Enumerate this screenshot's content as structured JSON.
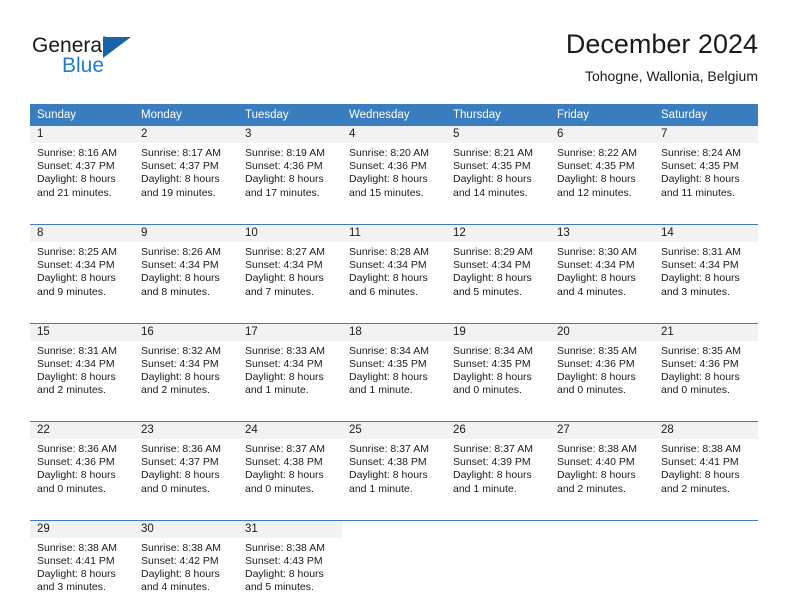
{
  "brand": {
    "name_top": "General",
    "name_bottom": "Blue",
    "accent_color": "#1f7fc4",
    "triangle_color": "#1565a8",
    "triangle_icon": "triangle-icon"
  },
  "header": {
    "title": "December 2024",
    "subtitle": "Tohogne, Wallonia, Belgium"
  },
  "calendar": {
    "header_bg": "#3a7dbf",
    "daynum_bg": "#f2f2f2",
    "weekday_headers": [
      "Sunday",
      "Monday",
      "Tuesday",
      "Wednesday",
      "Thursday",
      "Friday",
      "Saturday"
    ],
    "weeks": [
      [
        {
          "day": "1",
          "sunrise": "Sunrise: 8:16 AM",
          "sunset": "Sunset: 4:37 PM",
          "daylight1": "Daylight: 8 hours",
          "daylight2": "and 21 minutes."
        },
        {
          "day": "2",
          "sunrise": "Sunrise: 8:17 AM",
          "sunset": "Sunset: 4:37 PM",
          "daylight1": "Daylight: 8 hours",
          "daylight2": "and 19 minutes."
        },
        {
          "day": "3",
          "sunrise": "Sunrise: 8:19 AM",
          "sunset": "Sunset: 4:36 PM",
          "daylight1": "Daylight: 8 hours",
          "daylight2": "and 17 minutes."
        },
        {
          "day": "4",
          "sunrise": "Sunrise: 8:20 AM",
          "sunset": "Sunset: 4:36 PM",
          "daylight1": "Daylight: 8 hours",
          "daylight2": "and 15 minutes."
        },
        {
          "day": "5",
          "sunrise": "Sunrise: 8:21 AM",
          "sunset": "Sunset: 4:35 PM",
          "daylight1": "Daylight: 8 hours",
          "daylight2": "and 14 minutes."
        },
        {
          "day": "6",
          "sunrise": "Sunrise: 8:22 AM",
          "sunset": "Sunset: 4:35 PM",
          "daylight1": "Daylight: 8 hours",
          "daylight2": "and 12 minutes."
        },
        {
          "day": "7",
          "sunrise": "Sunrise: 8:24 AM",
          "sunset": "Sunset: 4:35 PM",
          "daylight1": "Daylight: 8 hours",
          "daylight2": "and 11 minutes."
        }
      ],
      [
        {
          "day": "8",
          "sunrise": "Sunrise: 8:25 AM",
          "sunset": "Sunset: 4:34 PM",
          "daylight1": "Daylight: 8 hours",
          "daylight2": "and 9 minutes."
        },
        {
          "day": "9",
          "sunrise": "Sunrise: 8:26 AM",
          "sunset": "Sunset: 4:34 PM",
          "daylight1": "Daylight: 8 hours",
          "daylight2": "and 8 minutes."
        },
        {
          "day": "10",
          "sunrise": "Sunrise: 8:27 AM",
          "sunset": "Sunset: 4:34 PM",
          "daylight1": "Daylight: 8 hours",
          "daylight2": "and 7 minutes."
        },
        {
          "day": "11",
          "sunrise": "Sunrise: 8:28 AM",
          "sunset": "Sunset: 4:34 PM",
          "daylight1": "Daylight: 8 hours",
          "daylight2": "and 6 minutes."
        },
        {
          "day": "12",
          "sunrise": "Sunrise: 8:29 AM",
          "sunset": "Sunset: 4:34 PM",
          "daylight1": "Daylight: 8 hours",
          "daylight2": "and 5 minutes."
        },
        {
          "day": "13",
          "sunrise": "Sunrise: 8:30 AM",
          "sunset": "Sunset: 4:34 PM",
          "daylight1": "Daylight: 8 hours",
          "daylight2": "and 4 minutes."
        },
        {
          "day": "14",
          "sunrise": "Sunrise: 8:31 AM",
          "sunset": "Sunset: 4:34 PM",
          "daylight1": "Daylight: 8 hours",
          "daylight2": "and 3 minutes."
        }
      ],
      [
        {
          "day": "15",
          "sunrise": "Sunrise: 8:31 AM",
          "sunset": "Sunset: 4:34 PM",
          "daylight1": "Daylight: 8 hours",
          "daylight2": "and 2 minutes."
        },
        {
          "day": "16",
          "sunrise": "Sunrise: 8:32 AM",
          "sunset": "Sunset: 4:34 PM",
          "daylight1": "Daylight: 8 hours",
          "daylight2": "and 2 minutes."
        },
        {
          "day": "17",
          "sunrise": "Sunrise: 8:33 AM",
          "sunset": "Sunset: 4:34 PM",
          "daylight1": "Daylight: 8 hours",
          "daylight2": "and 1 minute."
        },
        {
          "day": "18",
          "sunrise": "Sunrise: 8:34 AM",
          "sunset": "Sunset: 4:35 PM",
          "daylight1": "Daylight: 8 hours",
          "daylight2": "and 1 minute."
        },
        {
          "day": "19",
          "sunrise": "Sunrise: 8:34 AM",
          "sunset": "Sunset: 4:35 PM",
          "daylight1": "Daylight: 8 hours",
          "daylight2": "and 0 minutes."
        },
        {
          "day": "20",
          "sunrise": "Sunrise: 8:35 AM",
          "sunset": "Sunset: 4:36 PM",
          "daylight1": "Daylight: 8 hours",
          "daylight2": "and 0 minutes."
        },
        {
          "day": "21",
          "sunrise": "Sunrise: 8:35 AM",
          "sunset": "Sunset: 4:36 PM",
          "daylight1": "Daylight: 8 hours",
          "daylight2": "and 0 minutes."
        }
      ],
      [
        {
          "day": "22",
          "sunrise": "Sunrise: 8:36 AM",
          "sunset": "Sunset: 4:36 PM",
          "daylight1": "Daylight: 8 hours",
          "daylight2": "and 0 minutes."
        },
        {
          "day": "23",
          "sunrise": "Sunrise: 8:36 AM",
          "sunset": "Sunset: 4:37 PM",
          "daylight1": "Daylight: 8 hours",
          "daylight2": "and 0 minutes."
        },
        {
          "day": "24",
          "sunrise": "Sunrise: 8:37 AM",
          "sunset": "Sunset: 4:38 PM",
          "daylight1": "Daylight: 8 hours",
          "daylight2": "and 0 minutes."
        },
        {
          "day": "25",
          "sunrise": "Sunrise: 8:37 AM",
          "sunset": "Sunset: 4:38 PM",
          "daylight1": "Daylight: 8 hours",
          "daylight2": "and 1 minute."
        },
        {
          "day": "26",
          "sunrise": "Sunrise: 8:37 AM",
          "sunset": "Sunset: 4:39 PM",
          "daylight1": "Daylight: 8 hours",
          "daylight2": "and 1 minute."
        },
        {
          "day": "27",
          "sunrise": "Sunrise: 8:38 AM",
          "sunset": "Sunset: 4:40 PM",
          "daylight1": "Daylight: 8 hours",
          "daylight2": "and 2 minutes."
        },
        {
          "day": "28",
          "sunrise": "Sunrise: 8:38 AM",
          "sunset": "Sunset: 4:41 PM",
          "daylight1": "Daylight: 8 hours",
          "daylight2": "and 2 minutes."
        }
      ],
      [
        {
          "day": "29",
          "sunrise": "Sunrise: 8:38 AM",
          "sunset": "Sunset: 4:41 PM",
          "daylight1": "Daylight: 8 hours",
          "daylight2": "and 3 minutes."
        },
        {
          "day": "30",
          "sunrise": "Sunrise: 8:38 AM",
          "sunset": "Sunset: 4:42 PM",
          "daylight1": "Daylight: 8 hours",
          "daylight2": "and 4 minutes."
        },
        {
          "day": "31",
          "sunrise": "Sunrise: 8:38 AM",
          "sunset": "Sunset: 4:43 PM",
          "daylight1": "Daylight: 8 hours",
          "daylight2": "and 5 minutes."
        },
        {
          "day": "",
          "sunrise": "",
          "sunset": "",
          "daylight1": "",
          "daylight2": ""
        },
        {
          "day": "",
          "sunrise": "",
          "sunset": "",
          "daylight1": "",
          "daylight2": ""
        },
        {
          "day": "",
          "sunrise": "",
          "sunset": "",
          "daylight1": "",
          "daylight2": ""
        },
        {
          "day": "",
          "sunrise": "",
          "sunset": "",
          "daylight1": "",
          "daylight2": ""
        }
      ]
    ]
  }
}
